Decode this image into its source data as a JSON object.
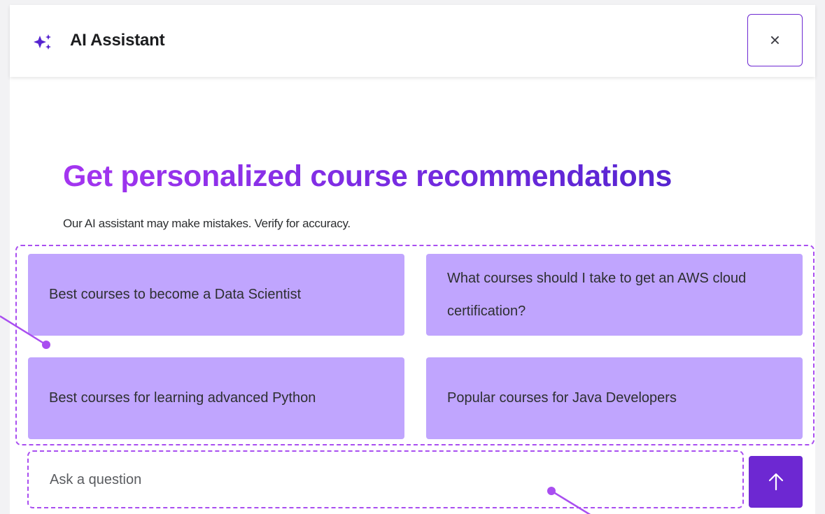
{
  "header": {
    "title": "AI Assistant",
    "close_label": "×"
  },
  "main": {
    "headline": "Get personalized course recommendations",
    "disclaimer": "Our AI assistant may make mistakes. Verify for accuracy.",
    "suggestions": [
      "Best courses to become a Data Scientist",
      "What courses should I take to get an AWS cloud certification?",
      "Best courses for learning advanced Python",
      "Popular courses for Java Developers"
    ]
  },
  "composer": {
    "placeholder": "Ask a question",
    "value": ""
  },
  "icons": {
    "header": "sparkle-icon",
    "close": "close-icon",
    "send": "arrow-up-icon"
  },
  "colors": {
    "accent": "#6d28d2",
    "suggestion_bg": "#c0a5fe",
    "annotation": "#a94ef0",
    "headline_gradient_start": "#a435f0",
    "headline_gradient_end": "#5624d0"
  }
}
